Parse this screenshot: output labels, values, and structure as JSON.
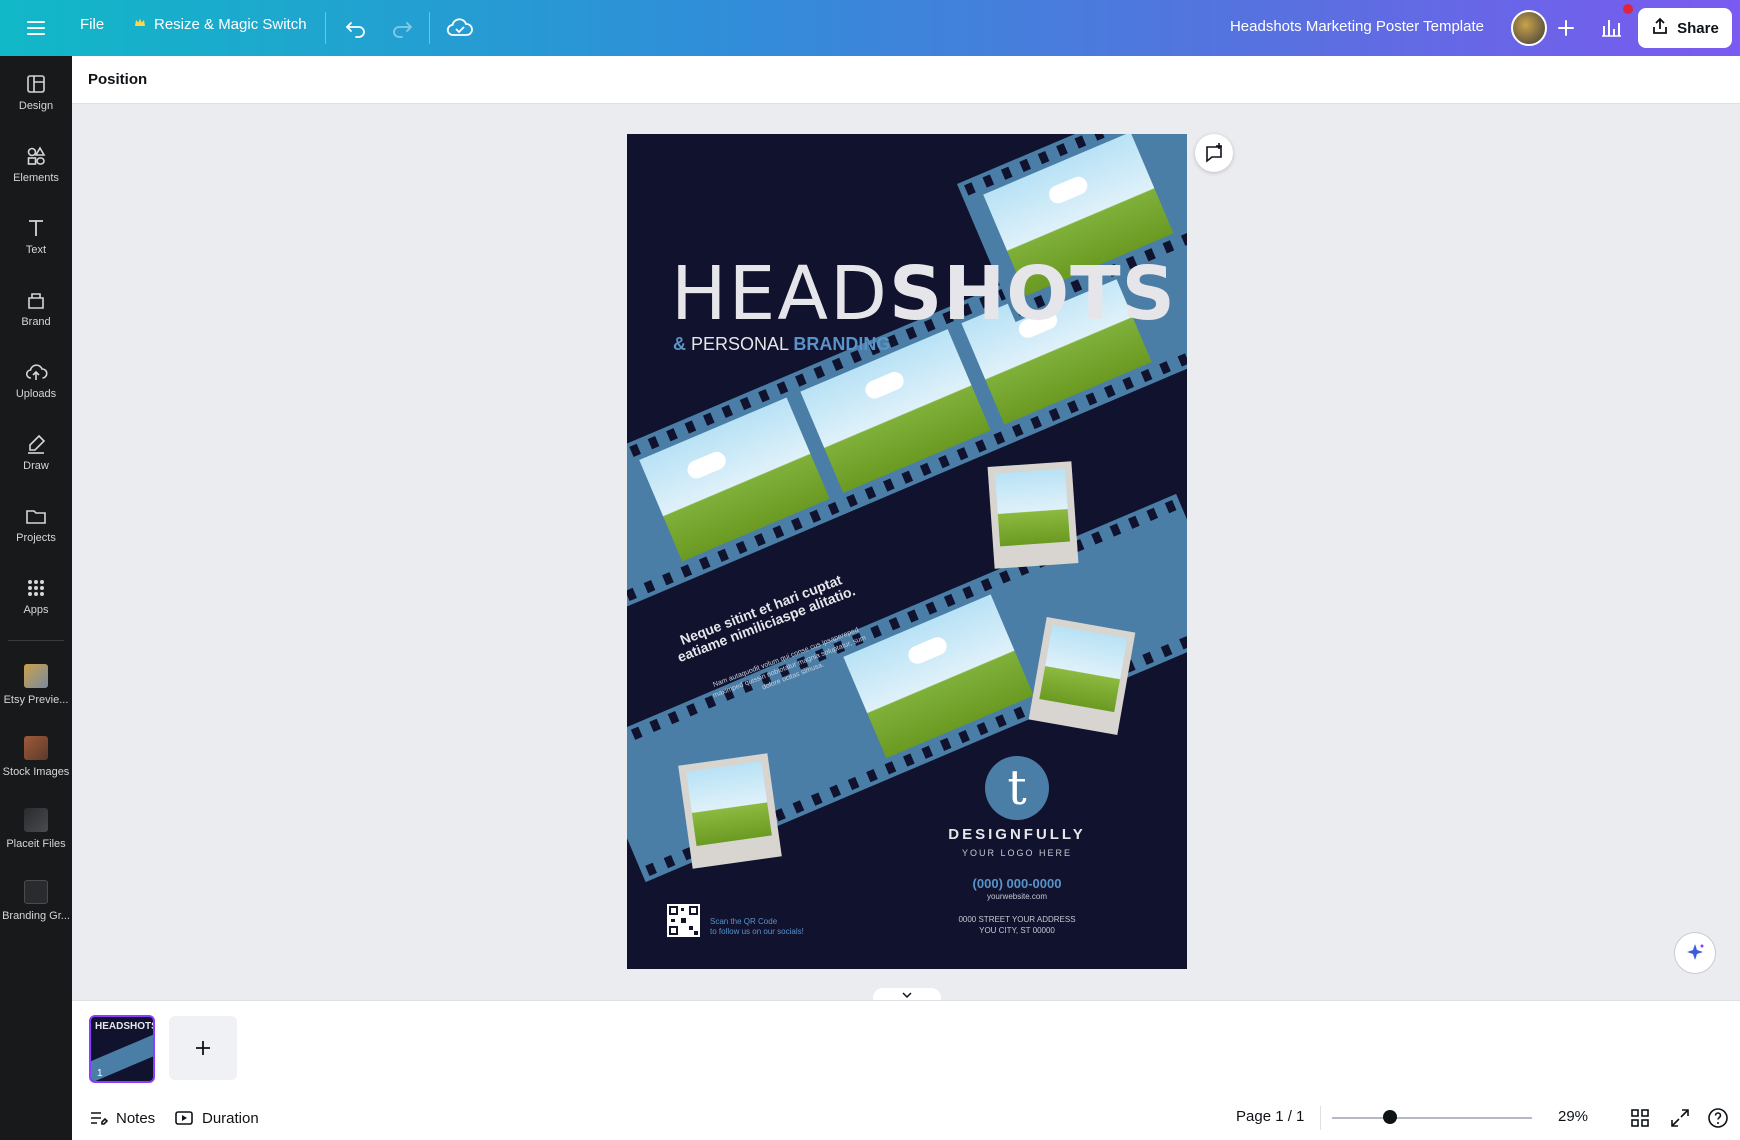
{
  "topbar": {
    "file_label": "File",
    "resize_label": "Resize & Magic Switch",
    "doc_title": "Headshots Marketing Poster Template",
    "share_label": "Share"
  },
  "sidebar": {
    "items": [
      {
        "label": "Design",
        "icon": "design-icon"
      },
      {
        "label": "Elements",
        "icon": "elements-icon"
      },
      {
        "label": "Text",
        "icon": "text-icon"
      },
      {
        "label": "Brand",
        "icon": "brand-icon"
      },
      {
        "label": "Uploads",
        "icon": "uploads-icon"
      },
      {
        "label": "Draw",
        "icon": "draw-icon"
      },
      {
        "label": "Projects",
        "icon": "projects-icon"
      },
      {
        "label": "Apps",
        "icon": "apps-icon"
      }
    ],
    "apps": [
      {
        "label": "Etsy Previe...",
        "icon": "etsy-preview-icon"
      },
      {
        "label": "Stock Images",
        "icon": "stock-images-icon"
      },
      {
        "label": "Placeit Files",
        "icon": "placeit-files-icon"
      },
      {
        "label": "Branding Gr...",
        "icon": "branding-grid-icon"
      }
    ]
  },
  "toolbar": {
    "position_label": "Position"
  },
  "poster": {
    "headline_light": "HEAD",
    "headline_bold": "SHOTS",
    "sub_amp": "&",
    "sub_personal": "PERSONAL",
    "sub_branding": "BRANDING",
    "lorem_title": "Neque sitint et hari cuptat eatiame nimiliciaspe alitatio.",
    "lorem_body": "Nam autaquodit volum qui conse cus ipsapereped maximped quissin nobiotatur magnia soluptatur, sum dolore ocitas simusa.",
    "logo_letter": "t",
    "logo_name": "DESIGNFULLY",
    "logo_tag": "YOUR LOGO HERE",
    "phone": "(000) 000-0000",
    "website": "yourwebsite.com",
    "address_line1": "0000 STREET YOUR ADDRESS",
    "address_line2": "YOU CITY, ST 00000",
    "qr_line1": "Scan the QR Code",
    "qr_line2": "to follow us on our socials!"
  },
  "pages": {
    "thumb_number": "1"
  },
  "footer": {
    "notes_label": "Notes",
    "duration_label": "Duration",
    "page_count": "Page 1 / 1",
    "zoom_value": "29%",
    "zoom_fraction": 0.29
  },
  "colors": {
    "accent": "#8b3dff",
    "poster_bg": "#10122e",
    "film_blue": "#4a7ea6",
    "brand_blue": "#5a93c8"
  }
}
